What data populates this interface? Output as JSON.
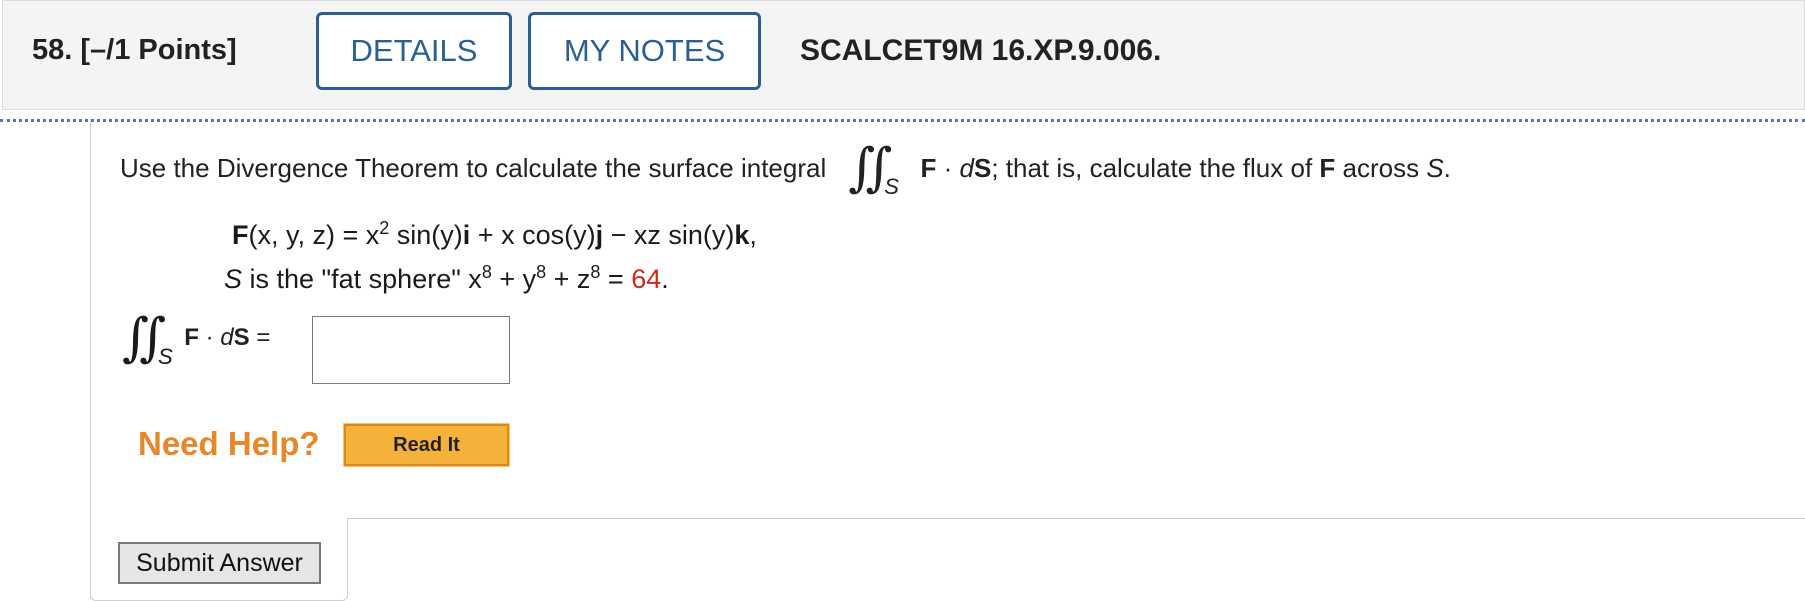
{
  "header": {
    "question_number": "58.",
    "points": "[–/1 Points]",
    "details_label": "DETAILS",
    "mynotes_label": "MY NOTES",
    "problem_code": "SCALCET9M 16.XP.9.006."
  },
  "question": {
    "prompt_before": "Use the Divergence Theorem to calculate the surface integral",
    "integral_symbol": "∬",
    "integral_sub": "S",
    "prompt_F": "F",
    "prompt_dot": " · ",
    "prompt_d": "d",
    "prompt_S": "S",
    "prompt_after_a": ";  that is, calculate the flux of ",
    "prompt_after_F": "F",
    "prompt_after_b": " across ",
    "prompt_after_S": "S",
    "prompt_after_c": ".",
    "field_line": {
      "F": "F",
      "args": "(x, y, z)",
      "eq": " = x",
      "sup2": "2",
      "t1": " sin(y)",
      "i": "i",
      "t2": " + x cos(y)",
      "j": "j",
      "t3": " − xz sin(y)",
      "k": "k",
      "t4": ","
    },
    "surface_line": {
      "S": "S",
      "text": " is the \"fat sphere\"  x",
      "sup_a": "8",
      "plus1": " + y",
      "sup_b": "8",
      "plus2": " + z",
      "sup_c": "8",
      "eq": " = ",
      "value": "64",
      "end": "."
    },
    "answer_F": "F",
    "answer_dot": " · ",
    "answer_d": "d",
    "answer_S": "S",
    "answer_eq": " =",
    "answer_value": ""
  },
  "help": {
    "need_help_label": "Need Help?",
    "read_it_label": "Read It"
  },
  "submit_label": "Submit Answer",
  "colors": {
    "button_border": "#2b5f93",
    "need_help": "#e8862a",
    "read_it_bg": "#f4b23a",
    "highlight_value": "#d0281c",
    "dotted_divider": "#4a78c2"
  }
}
